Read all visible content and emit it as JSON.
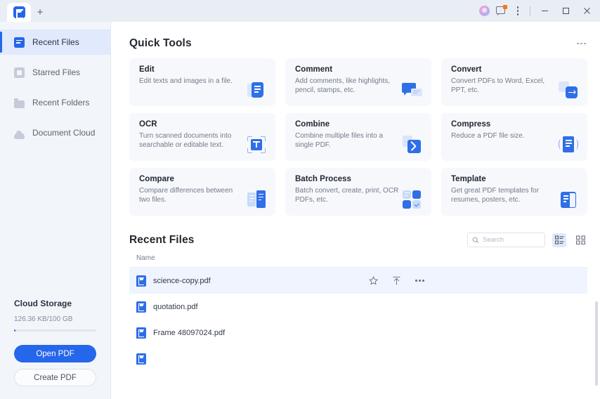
{
  "titlebar": {
    "app_logo": "pdf-app-logo",
    "new_tab_label": "+",
    "icons": [
      "user-avatar",
      "message-icon",
      "more-vertical-icon",
      "minimize-icon",
      "maximize-icon",
      "close-icon"
    ]
  },
  "sidebar": {
    "items": [
      {
        "label": "Recent Files",
        "icon": "recent-files-icon",
        "active": true
      },
      {
        "label": "Starred Files",
        "icon": "starred-files-icon",
        "active": false
      },
      {
        "label": "Recent Folders",
        "icon": "folder-icon",
        "active": false
      },
      {
        "label": "Document Cloud",
        "icon": "cloud-icon",
        "active": false
      }
    ],
    "cloud": {
      "title": "Cloud Storage",
      "usage": "126.36 KB/100 GB",
      "open_pdf": "Open PDF",
      "create_pdf": "Create PDF"
    }
  },
  "quick_tools": {
    "title": "Quick Tools",
    "more_icon": "more-horizontal-icon",
    "cards": [
      {
        "name": "Edit",
        "desc": "Edit texts and images in a file.",
        "icon": "edit-icon"
      },
      {
        "name": "Comment",
        "desc": "Add comments, like highlights, pencil, stamps, etc.",
        "icon": "comment-icon"
      },
      {
        "name": "Convert",
        "desc": "Convert PDFs to Word, Excel, PPT, etc.",
        "icon": "convert-icon"
      },
      {
        "name": "OCR",
        "desc": "Turn scanned documents into searchable or editable text.",
        "icon": "ocr-icon"
      },
      {
        "name": "Combine",
        "desc": "Combine multiple files into a single PDF.",
        "icon": "combine-icon"
      },
      {
        "name": "Compress",
        "desc": "Reduce a PDF file size.",
        "icon": "compress-icon"
      },
      {
        "name": "Compare",
        "desc": "Compare differences between two files.",
        "icon": "compare-icon"
      },
      {
        "name": "Batch Process",
        "desc": "Batch convert, create, print, OCR PDFs, etc.",
        "icon": "batch-process-icon"
      },
      {
        "name": "Template",
        "desc": "Get great PDF templates for resumes, posters, etc.",
        "icon": "template-icon"
      }
    ]
  },
  "recent_files": {
    "title": "Recent Files",
    "search_placeholder": "Search",
    "search_value": "",
    "column_header": "Name",
    "view_list_icon": "list-view-icon",
    "view_grid_icon": "grid-view-icon",
    "files": [
      {
        "name": "science-copy.pdf",
        "selected": true
      },
      {
        "name": "quotation.pdf",
        "selected": false
      },
      {
        "name": "Frame 48097024.pdf",
        "selected": false
      }
    ],
    "row_actions": [
      "star-icon",
      "upload-icon",
      "more-horizontal-icon"
    ]
  },
  "colors": {
    "accent": "#2566ea",
    "card_bg": "#f6f8fc",
    "selected_row": "#eff4fe",
    "sidebar_bg": "#f2f5fa",
    "badge": "#f97316"
  }
}
